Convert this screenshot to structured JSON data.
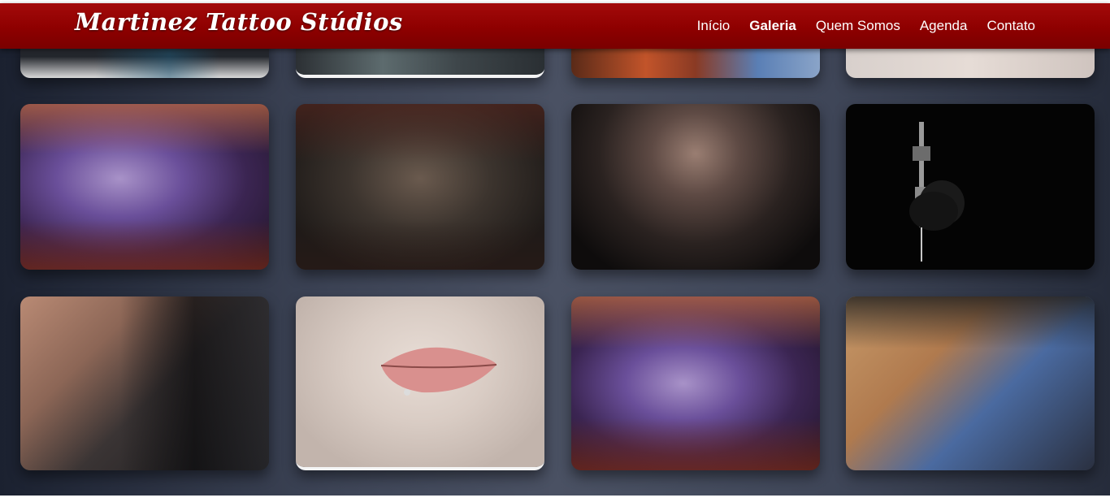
{
  "site": {
    "brand": "Martinez Tattoo Stúdios"
  },
  "nav": {
    "items": [
      {
        "label": "Início",
        "active": false
      },
      {
        "label": "Galeria",
        "active": true
      },
      {
        "label": "Quem Somos",
        "active": false
      },
      {
        "label": "Agenda",
        "active": false
      },
      {
        "label": "Contato",
        "active": false
      }
    ]
  },
  "gallery": {
    "rows": [
      [
        "tattoo-studio-photo",
        "tattoo-session-photo",
        "tattoo-client-photo",
        "skin-closeup-photo"
      ],
      [
        "arm-tattoo-session-photo",
        "forearm-tattoo-photo",
        "tattooed-woman-portrait-photo",
        "tattoo-machine-photo"
      ],
      [
        "hand-tattoo-session-photo",
        "lip-piercing-photo",
        "arm-tattoo-session-photo",
        "chest-tattoo-session-photo"
      ]
    ],
    "colors": {
      "header": "#8e0000",
      "accent": "#a30a0a"
    }
  }
}
